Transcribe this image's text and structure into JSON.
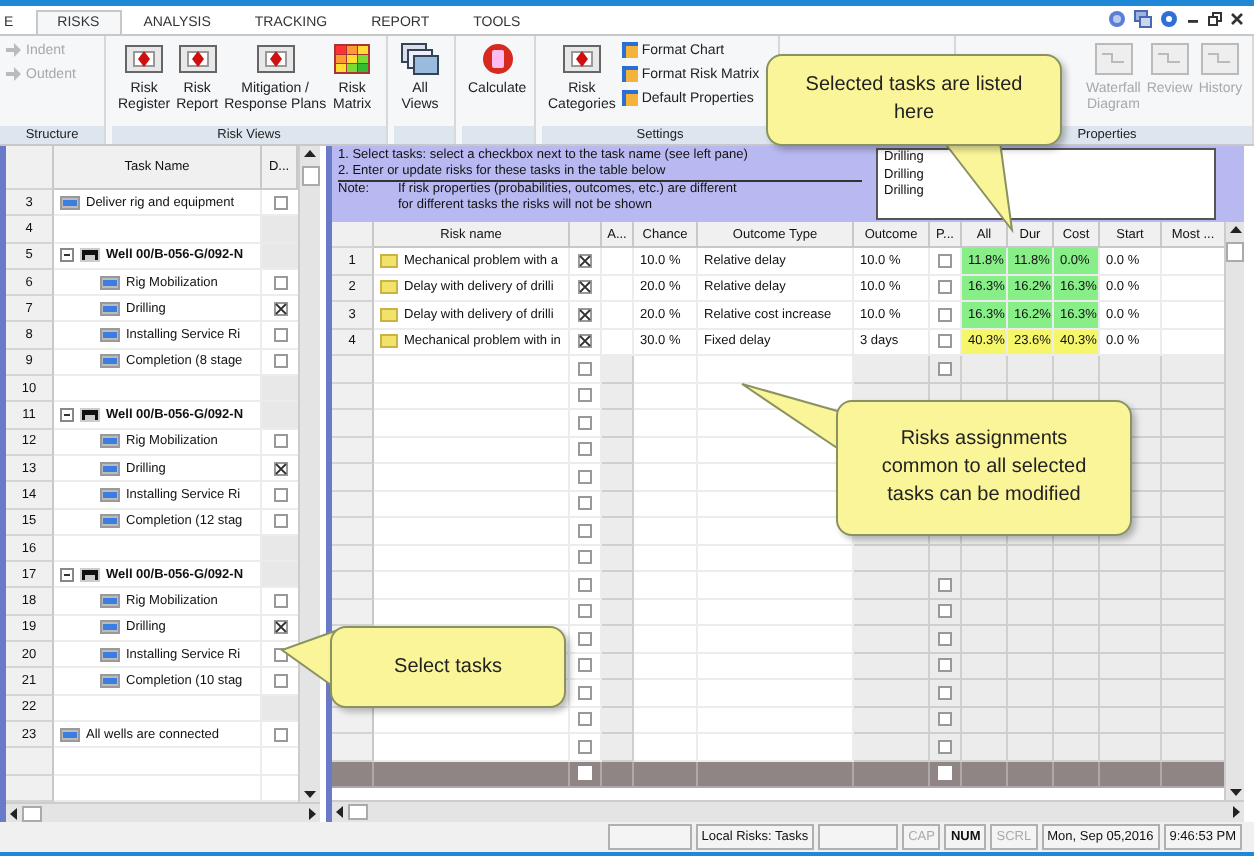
{
  "ribbon": {
    "tabs": [
      {
        "label": "E",
        "selected": false
      },
      {
        "label": "RISKS",
        "selected": true
      },
      {
        "label": "ANALYSIS",
        "selected": false
      },
      {
        "label": "TRACKING",
        "selected": false
      },
      {
        "label": "REPORT",
        "selected": false
      },
      {
        "label": "TOOLS",
        "selected": false
      }
    ],
    "groups": [
      {
        "label": "Structure",
        "items": [
          {
            "kind": "small",
            "lines": [
              "Indent"
            ],
            "disabled": true
          },
          {
            "kind": "small",
            "lines": [
              "Outdent"
            ],
            "disabled": true
          }
        ]
      },
      {
        "label": "Risk Views",
        "items": [
          {
            "kind": "large",
            "lines": [
              "Risk",
              "Register"
            ],
            "disabled": false
          },
          {
            "kind": "large",
            "lines": [
              "Risk",
              "Report"
            ],
            "disabled": false
          },
          {
            "kind": "large",
            "lines": [
              "Mitigation /",
              "Response Plans"
            ],
            "disabled": false
          },
          {
            "kind": "large",
            "lines": [
              "Risk",
              "Matrix"
            ],
            "disabled": false
          }
        ]
      },
      {
        "items": [
          {
            "kind": "large",
            "lines": [
              "All",
              "Views"
            ],
            "disabled": false
          }
        ]
      },
      {
        "items": [
          {
            "kind": "large",
            "lines": [
              "Calculate"
            ],
            "disabled": false
          }
        ]
      },
      {
        "label": "Settings",
        "items": [
          {
            "kind": "large",
            "lines": [
              "Risk",
              "Categories"
            ],
            "disabled": false
          },
          {
            "kind": "small",
            "lines": [
              "Format Chart"
            ],
            "disabled": false
          },
          {
            "kind": "small",
            "lines": [
              "Format Risk Matrix"
            ],
            "disabled": false
          },
          {
            "kind": "small",
            "lines": [
              "Default Properties"
            ],
            "disabled": false
          }
        ]
      },
      {
        "label": "Properties",
        "items": [
          {
            "kind": "large",
            "lines": [
              "Waterfall",
              "Diagram"
            ],
            "disabled": true
          },
          {
            "kind": "large",
            "lines": [
              "Review"
            ],
            "disabled": true
          },
          {
            "kind": "large",
            "lines": [
              "History"
            ],
            "disabled": true
          }
        ]
      }
    ]
  },
  "task_pane": {
    "columns": [
      "Task Name",
      "D..."
    ],
    "rows": [
      {
        "row": "3",
        "kind": "task",
        "name": "Deliver rig and equipment",
        "checked": false
      },
      {
        "row": "4",
        "kind": "blank"
      },
      {
        "row": "5",
        "kind": "summary",
        "name": "Well 00/B-056-G/092-N",
        "expanded": true,
        "children": [
          {
            "row": "6",
            "kind": "task",
            "name": "Rig Mobilization",
            "checked": false
          },
          {
            "row": "7",
            "kind": "task",
            "name": "Drilling",
            "checked": true
          },
          {
            "row": "8",
            "kind": "task",
            "name": "Installing Service Ri",
            "checked": false
          },
          {
            "row": "9",
            "kind": "task",
            "name": "Completion (8 stage",
            "checked": false
          }
        ]
      },
      {
        "row": "10",
        "kind": "blank"
      },
      {
        "row": "11",
        "kind": "summary",
        "name": "Well 00/B-056-G/092-N",
        "expanded": true,
        "children": [
          {
            "row": "12",
            "kind": "task",
            "name": "Rig Mobilization",
            "checked": false
          },
          {
            "row": "13",
            "kind": "task",
            "name": "Drilling",
            "checked": true
          },
          {
            "row": "14",
            "kind": "task",
            "name": "Installing Service Ri",
            "checked": false
          },
          {
            "row": "15",
            "kind": "task",
            "name": "Completion (12 stag",
            "checked": false
          }
        ]
      },
      {
        "row": "16",
        "kind": "blank"
      },
      {
        "row": "17",
        "kind": "summary",
        "name": "Well 00/B-056-G/092-N",
        "expanded": true,
        "children": [
          {
            "row": "18",
            "kind": "task",
            "name": "Rig Mobilization",
            "checked": false
          },
          {
            "row": "19",
            "kind": "task",
            "name": "Drilling",
            "checked": true
          },
          {
            "row": "20",
            "kind": "task",
            "name": "Installing Service Ri",
            "checked": false
          },
          {
            "row": "21",
            "kind": "task",
            "name": "Completion (10 stag",
            "checked": false
          }
        ]
      },
      {
        "row": "22",
        "kind": "blank"
      },
      {
        "row": "23",
        "kind": "task",
        "name": "All wells are connected",
        "checked": false
      }
    ]
  },
  "risk_pane": {
    "instructions": [
      "1. Select tasks: select a checkbox next to the task name (see left pane)",
      "2. Enter or update risks for these tasks in the table below"
    ],
    "note_label": "Note:",
    "note_lines": [
      "If risk properties (probabilities, outcomes, etc.) are different",
      "for different tasks the risks will not be shown"
    ],
    "selected_tasks": [
      "Drilling",
      "Drilling",
      "Drilling"
    ],
    "columns": [
      "Risk name",
      "A...",
      "Chance",
      "Outcome Type",
      "Outcome",
      "P...",
      "All",
      "Dur",
      "Cost",
      "Start",
      "Most ..."
    ],
    "rows": [
      {
        "row": "1",
        "name": "Mechanical problem with a",
        "assigned": true,
        "chance": "10.0 %",
        "outcome_type": "Relative delay",
        "outcome": "10.0 %",
        "p": false,
        "all": "11.8%",
        "dur": "11.8%",
        "cost": "0.0%",
        "color": "#88ee88",
        "start": "0.0 %"
      },
      {
        "row": "2",
        "name": "Delay with delivery of drilli",
        "assigned": true,
        "chance": "20.0 %",
        "outcome_type": "Relative delay",
        "outcome": "10.0 %",
        "p": false,
        "all": "16.3%",
        "dur": "16.2%",
        "cost": "16.3%",
        "color": "#88ee88",
        "start": "0.0 %"
      },
      {
        "row": "3",
        "name": "Delay with delivery of drilli",
        "assigned": true,
        "chance": "20.0 %",
        "outcome_type": "Relative cost increase",
        "outcome": "10.0 %",
        "p": false,
        "all": "16.3%",
        "dur": "16.2%",
        "cost": "16.3%",
        "color": "#88ee88",
        "start": "0.0 %"
      },
      {
        "row": "4",
        "name": "Mechanical problem with in",
        "assigned": true,
        "chance": "30.0 %",
        "outcome_type": "Fixed delay",
        "outcome": "3 days",
        "p": false,
        "all": "40.3%",
        "dur": "23.6%",
        "cost": "40.3%",
        "color": "#f6f66a",
        "start": "0.0 %"
      }
    ],
    "blank_rows": [
      {
        "kind": "empty",
        "assigned": false,
        "p": false
      },
      {
        "kind": "empty",
        "assigned": false
      },
      {
        "kind": "empty",
        "assigned": false
      },
      {
        "kind": "empty",
        "assigned": false
      },
      {
        "kind": "empty",
        "assigned": false
      },
      {
        "kind": "empty",
        "assigned": false
      },
      {
        "kind": "empty",
        "assigned": false
      },
      {
        "kind": "empty",
        "assigned": false
      },
      {
        "kind": "empty",
        "assigned": false,
        "p": false
      },
      {
        "kind": "empty",
        "assigned": false,
        "p": false
      },
      {
        "kind": "empty",
        "assigned": false,
        "p": false
      },
      {
        "kind": "empty",
        "assigned": false,
        "p": false
      },
      {
        "kind": "empty",
        "assigned": false,
        "p": false
      },
      {
        "kind": "empty",
        "assigned": false,
        "p": false
      },
      {
        "kind": "empty",
        "assigned": false,
        "p": false
      },
      {
        "kind": "new",
        "assigned": false,
        "p": false
      }
    ]
  },
  "status_bar": {
    "mode": "Local Risks: Tasks",
    "indicators": [
      {
        "label": "CAP",
        "on": false
      },
      {
        "label": "NUM",
        "on": true
      },
      {
        "label": "SCRL",
        "on": false
      }
    ],
    "date": "Mon, Sep 05,2016",
    "time": "9:46:53 PM"
  },
  "callouts": [
    {
      "kind": "down",
      "text": "Selected tasks are listed here"
    },
    {
      "kind": "up-left",
      "text": "Risks assignments common to all selected tasks can be modified"
    },
    {
      "kind": "left",
      "text": "Select tasks"
    }
  ]
}
